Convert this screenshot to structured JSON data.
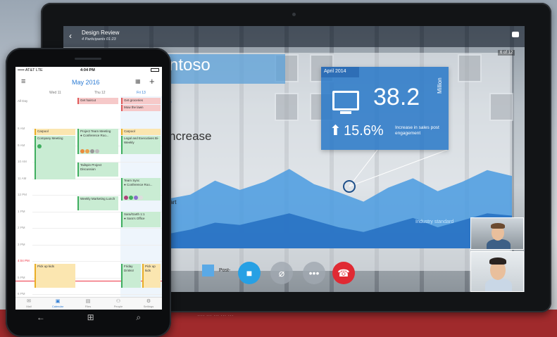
{
  "background": {
    "band_color": "#a02a2c",
    "band_text": "···· ··· ··· ··· ···"
  },
  "tablet": {
    "meeting": {
      "title": "Design Review",
      "subtitle": "4 Participants 01:23",
      "page_indicator": "6 of 12",
      "back_icon": "chevron-left-icon",
      "chat_icon": "chat-icon"
    },
    "slide": {
      "title_fragment": "ntoso",
      "s_fragment": "s",
      "heading_fragment": "ncrease",
      "start_fragment": "nt start",
      "stats": {
        "date": "April 2014",
        "value": "38.2",
        "unit": "Million",
        "percent": "15.6%",
        "percent_desc": "Increase in sales post engagement"
      },
      "legend_label": "Post-",
      "industry_label": "Industry standard",
      "accent": "#2f7ec4"
    },
    "controls": {
      "video": "video-icon",
      "mic": "mic-off-icon",
      "more": "more-icon",
      "hangup": "hangup-icon",
      "hangup_color": "#e02a33",
      "video_color": "#27a0e4"
    }
  },
  "chart_data": {
    "type": "area",
    "series": [
      {
        "values": [
          38,
          42,
          46,
          58,
          50,
          57,
          68,
          55,
          48,
          40,
          52,
          60,
          49,
          57,
          67,
          62
        ]
      },
      {
        "values": [
          8,
          12,
          16,
          22,
          20,
          25,
          30,
          24,
          18,
          14,
          20,
          26,
          18,
          24,
          30,
          28
        ]
      }
    ],
    "ylim": [
      0,
      100
    ],
    "colors": [
      "#4a9be0",
      "#2a74c4"
    ]
  },
  "phone": {
    "status": {
      "carrier": "••••• AT&T  LTE",
      "time": "4:04 PM"
    },
    "month": "May 2016",
    "days": [
      "Wed 11",
      "Thu 12",
      "Fri 13"
    ],
    "all_day_label": "All Day",
    "hours": [
      "8 AM",
      "9 AM",
      "10 AM",
      "11 AM",
      "12 PM",
      "1 PM",
      "2 PM",
      "3 PM",
      "4:04 PM",
      "5 PM",
      "6 PM"
    ],
    "events": {
      "get_haircut": "Get haircut",
      "get_groceries": "Get groceries",
      "mow_lawn": "Mow the lawn",
      "carpool_1": "Carpool",
      "company_meeting": "Company Meeting",
      "project_team": "Project Team Meeting",
      "project_team_loc": "● Conference Roo...",
      "carpool_2": "Carpool",
      "legal": "Legal and Executives Bi-Weekly",
      "tailspin": "Tailspin Project Discussion",
      "team_sync": "Team Sync",
      "team_sync_loc": "● Conference Roo...",
      "weekly_marketing": "Weekly Marketing Lunch",
      "sara_garth": "Sara/Garth 1:1",
      "sara_office": "● Sara's Office",
      "pickup_1": "Pick up kids",
      "friday_drinks": "Friday Drinks!",
      "pickup_2": "Pick up kids"
    },
    "tabs": [
      {
        "label": "Mail",
        "icon": "mail-icon"
      },
      {
        "label": "Calendar",
        "icon": "calendar-icon"
      },
      {
        "label": "Files",
        "icon": "files-icon"
      },
      {
        "label": "People",
        "icon": "people-icon"
      },
      {
        "label": "Settings",
        "icon": "settings-icon"
      }
    ],
    "nav": {
      "back": "back-icon",
      "home": "windows-icon",
      "search": "search-icon"
    }
  }
}
